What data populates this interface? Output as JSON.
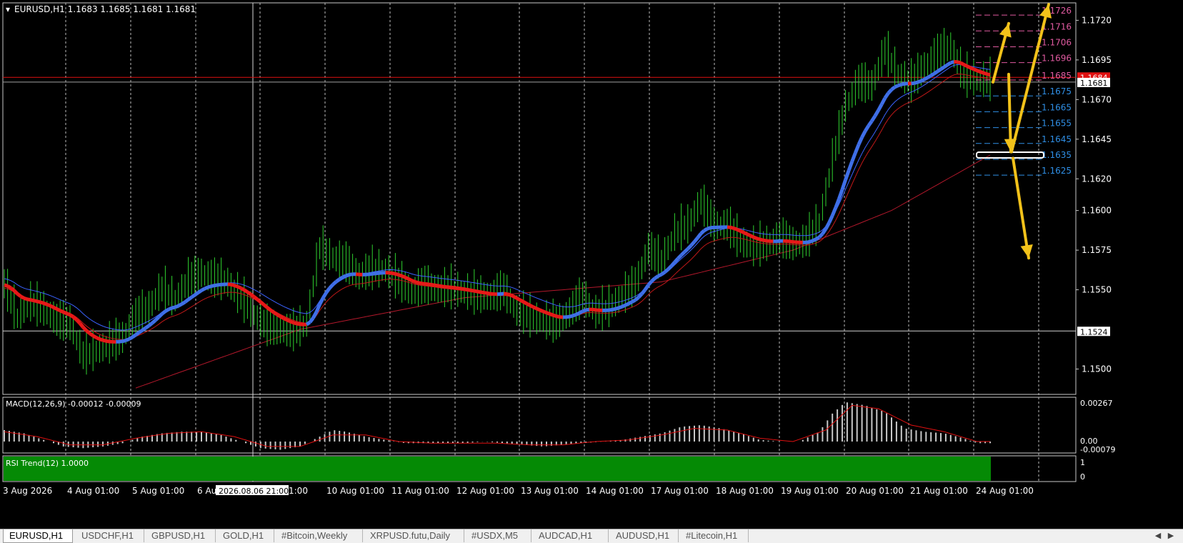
{
  "window": {
    "header": "EURUSD,H1  1.1683 1.1685 1.1681 1.1681",
    "dropdown_arrow": "triangle-down-icon"
  },
  "chart_data": [
    {
      "type": "line",
      "panel": "main",
      "symbol": "EURUSD",
      "timeframe": "H1",
      "ohlc": {
        "open": 1.1683,
        "high": 1.1685,
        "low": 1.1681,
        "close": 1.1681
      },
      "ylim": [
        1.1484,
        1.1731
      ],
      "y_ticks": [
        "1.1720",
        "1.1695",
        "1.1670",
        "1.1645",
        "1.1620",
        "1.1600",
        "1.1575",
        "1.1550",
        "1.1500"
      ],
      "x_ticks": [
        "3 Aug 2026",
        "4 Aug 01:00",
        "5 Aug 01:00",
        "6 Au",
        "10 Aug 01:00",
        "11 Aug 01:00",
        "12 Aug 01:00",
        "13 Aug 01:00",
        "14 Aug 01:00",
        "17 Aug 01:00",
        "18 Aug 01:00",
        "19 Aug 01:00",
        "20 Aug 01:00",
        "21 Aug 01:00",
        "24 Aug 01:00"
      ],
      "x_ticks_partial": "1:00",
      "crosshair_time": "2026.08.06 21:00",
      "current_price_label": "1.1681",
      "red_line_label": "1.1684",
      "horizontal_level_label": "1.1524",
      "price_series": [
        [
          0,
          1.1553
        ],
        [
          4,
          1.1532
        ],
        [
          8,
          1.1541
        ],
        [
          12,
          1.1537
        ],
        [
          16,
          1.153
        ],
        [
          20,
          1.1528
        ],
        [
          24,
          1.1508
        ],
        [
          28,
          1.1511
        ],
        [
          32,
          1.1515
        ],
        [
          36,
          1.1519
        ],
        [
          40,
          1.1532
        ],
        [
          44,
          1.1538
        ],
        [
          48,
          1.155
        ],
        [
          52,
          1.1543
        ],
        [
          56,
          1.1555
        ],
        [
          60,
          1.156
        ],
        [
          64,
          1.1556
        ],
        [
          68,
          1.1554
        ],
        [
          72,
          1.1544
        ],
        [
          76,
          1.1534
        ],
        [
          80,
          1.1526
        ],
        [
          84,
          1.1524
        ],
        [
          88,
          1.1523
        ],
        [
          92,
          1.1528
        ],
        [
          96,
          1.1576
        ],
        [
          100,
          1.157
        ],
        [
          104,
          1.1566
        ],
        [
          108,
          1.1558
        ],
        [
          112,
          1.1562
        ],
        [
          116,
          1.1562
        ],
        [
          120,
          1.1555
        ],
        [
          124,
          1.1548
        ],
        [
          128,
          1.1552
        ],
        [
          132,
          1.155
        ],
        [
          136,
          1.155
        ],
        [
          140,
          1.1548
        ],
        [
          144,
          1.1546
        ],
        [
          148,
          1.1545
        ],
        [
          152,
          1.1549
        ],
        [
          156,
          1.1536
        ],
        [
          160,
          1.1532
        ],
        [
          164,
          1.153
        ],
        [
          168,
          1.1528
        ],
        [
          172,
          1.1535
        ],
        [
          176,
          1.1545
        ],
        [
          180,
          1.1535
        ],
        [
          184,
          1.1538
        ],
        [
          188,
          1.1545
        ],
        [
          192,
          1.1552
        ],
        [
          196,
          1.1575
        ],
        [
          200,
          1.1567
        ],
        [
          204,
          1.1585
        ],
        [
          208,
          1.159
        ],
        [
          212,
          1.1605
        ],
        [
          216,
          1.159
        ],
        [
          220,
          1.159
        ],
        [
          224,
          1.158
        ],
        [
          228,
          1.1576
        ],
        [
          232,
          1.1578
        ],
        [
          236,
          1.1582
        ],
        [
          240,
          1.1578
        ],
        [
          244,
          1.158
        ],
        [
          248,
          1.1592
        ],
        [
          252,
          1.163
        ],
        [
          256,
          1.1665
        ],
        [
          260,
          1.168
        ],
        [
          264,
          1.1678
        ],
        [
          268,
          1.17
        ],
        [
          272,
          1.1686
        ],
        [
          276,
          1.168
        ],
        [
          280,
          1.169
        ],
        [
          284,
          1.1698
        ],
        [
          288,
          1.1703
        ],
        [
          292,
          1.1684
        ],
        [
          296,
          1.1682
        ],
        [
          300,
          1.1681
        ]
      ],
      "fib_levels_up": [
        "1.1726",
        "1.1716",
        "1.1706",
        "1.1696",
        "1.1685"
      ],
      "fib_levels_down": [
        "1.1675",
        "1.1665",
        "1.1655",
        "1.1645",
        "1.1635",
        "1.1625"
      ],
      "arrows": [
        "up to 1.1726",
        "down to 1.1635",
        "down toward 1.1570"
      ],
      "colors": {
        "up_levels": "#e05aa0",
        "down_levels": "#2f8fe6",
        "arrows": "#f2c21a",
        "ema": "#b2182b"
      }
    },
    {
      "type": "bar",
      "panel": "macd",
      "label": "MACD(12,26,9) -0.00012 -0.00009",
      "y_ticks": [
        "0.00267",
        "0.00",
        "-0.00079"
      ],
      "histogram_scale": "x0.0001",
      "histogram": [
        [
          0,
          7
        ],
        [
          6,
          5
        ],
        [
          12,
          1
        ],
        [
          18,
          -3
        ],
        [
          24,
          -4
        ],
        [
          30,
          -3
        ],
        [
          36,
          -1
        ],
        [
          42,
          3
        ],
        [
          48,
          5
        ],
        [
          54,
          6
        ],
        [
          60,
          6
        ],
        [
          66,
          4
        ],
        [
          72,
          0
        ],
        [
          78,
          -4
        ],
        [
          84,
          -5
        ],
        [
          90,
          -3
        ],
        [
          96,
          3
        ],
        [
          100,
          7
        ],
        [
          104,
          6
        ],
        [
          110,
          3
        ],
        [
          116,
          1
        ],
        [
          122,
          -1
        ],
        [
          128,
          -1
        ],
        [
          134,
          -1
        ],
        [
          140,
          -1
        ],
        [
          146,
          0
        ],
        [
          152,
          -1
        ],
        [
          158,
          -2
        ],
        [
          164,
          -3
        ],
        [
          170,
          -2
        ],
        [
          176,
          -1
        ],
        [
          182,
          0
        ],
        [
          188,
          1
        ],
        [
          194,
          3
        ],
        [
          200,
          5
        ],
        [
          206,
          9
        ],
        [
          212,
          10
        ],
        [
          218,
          8
        ],
        [
          224,
          5
        ],
        [
          230,
          1
        ],
        [
          236,
          0
        ],
        [
          242,
          0
        ],
        [
          248,
          6
        ],
        [
          252,
          17
        ],
        [
          256,
          24
        ],
        [
          262,
          22
        ],
        [
          268,
          18
        ],
        [
          274,
          8
        ],
        [
          280,
          6
        ],
        [
          286,
          5
        ],
        [
          292,
          2
        ],
        [
          296,
          -1
        ],
        [
          300,
          -1
        ]
      ],
      "signal": [
        [
          0,
          6
        ],
        [
          10,
          3
        ],
        [
          20,
          -2
        ],
        [
          30,
          -2
        ],
        [
          40,
          2
        ],
        [
          50,
          5
        ],
        [
          60,
          6
        ],
        [
          70,
          3
        ],
        [
          80,
          -3
        ],
        [
          90,
          -3
        ],
        [
          100,
          4
        ],
        [
          110,
          4
        ],
        [
          120,
          0
        ],
        [
          130,
          -1
        ],
        [
          140,
          -1
        ],
        [
          150,
          -1
        ],
        [
          160,
          -2
        ],
        [
          170,
          -2
        ],
        [
          180,
          0
        ],
        [
          190,
          1
        ],
        [
          200,
          4
        ],
        [
          210,
          8
        ],
        [
          220,
          7
        ],
        [
          230,
          2
        ],
        [
          240,
          0
        ],
        [
          250,
          7
        ],
        [
          258,
          22
        ],
        [
          266,
          20
        ],
        [
          276,
          10
        ],
        [
          286,
          6
        ],
        [
          296,
          0
        ],
        [
          300,
          0
        ]
      ]
    },
    {
      "type": "area",
      "panel": "rsi_trend",
      "label": "RSI Trend(12) 1.0000",
      "y_ticks": [
        "1",
        "0"
      ],
      "value": 1.0
    }
  ],
  "tabs": [
    {
      "label": "EURUSD,H1",
      "active": true
    },
    {
      "label": "USDCHF,H1",
      "active": false
    },
    {
      "label": "GBPUSD,H1",
      "active": false
    },
    {
      "label": "GOLD,H1",
      "active": false
    },
    {
      "label": "#Bitcoin,Weekly",
      "active": false
    },
    {
      "label": "XRPUSD.futu,Daily",
      "active": false
    },
    {
      "label": "#USDX,M5",
      "active": false
    },
    {
      "label": "AUDCAD,H1",
      "active": false
    },
    {
      "label": "AUDUSD,H1",
      "active": false
    },
    {
      "label": "#Litecoin,H1",
      "active": false
    }
  ],
  "scroll": {
    "left_icon": "◀",
    "right_icon": "▶"
  }
}
